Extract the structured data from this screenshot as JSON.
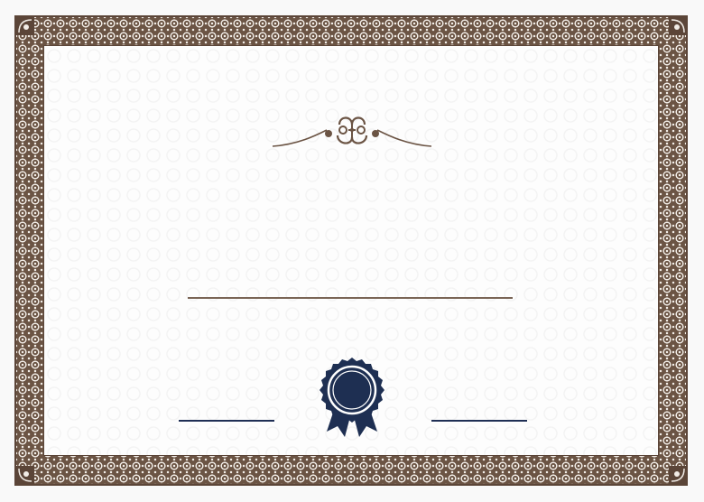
{
  "certificate": {
    "border_color": "#6b5444",
    "line_color": "#7a6556",
    "seal_color": "#1e2f52",
    "ornament_icon": "flourish-ornament-icon",
    "seal_icon": "award-rosette-icon"
  }
}
